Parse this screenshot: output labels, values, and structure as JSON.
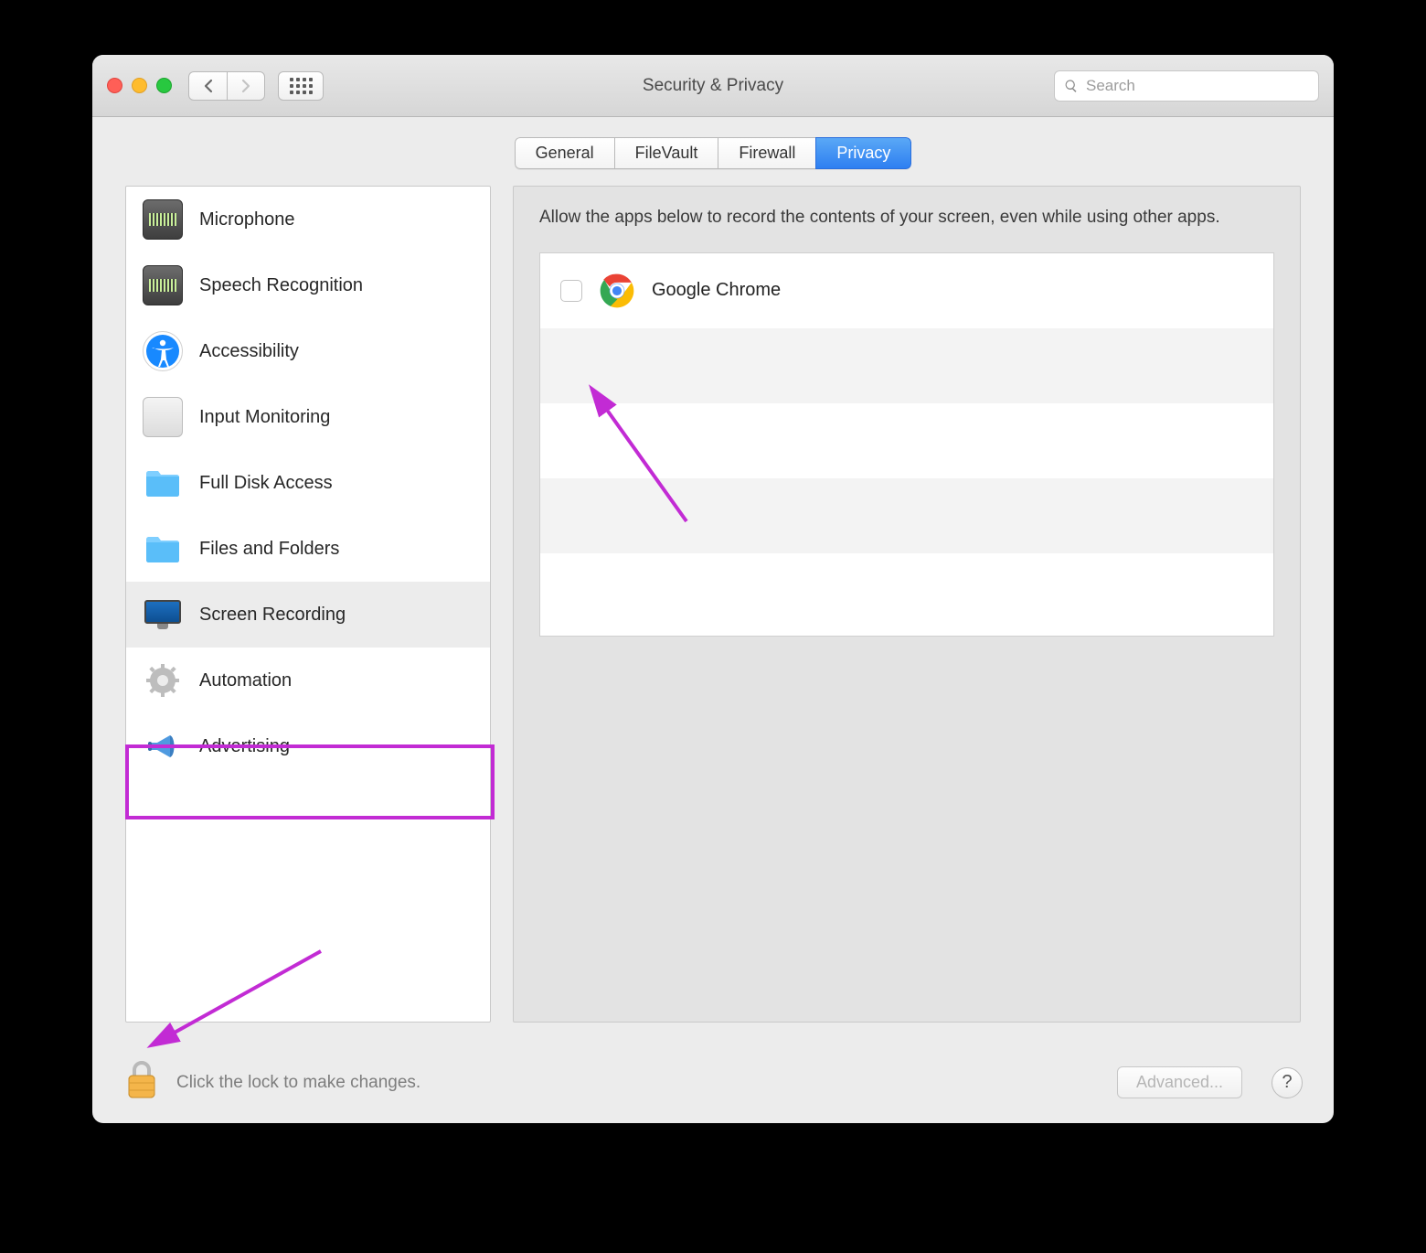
{
  "window": {
    "title": "Security & Privacy"
  },
  "search": {
    "placeholder": "Search"
  },
  "tabs": [
    {
      "label": "General",
      "active": false
    },
    {
      "label": "FileVault",
      "active": false
    },
    {
      "label": "Firewall",
      "active": false
    },
    {
      "label": "Privacy",
      "active": true
    }
  ],
  "sidebar": {
    "items": [
      {
        "label": "Microphone",
        "icon": "mic-icon",
        "selected": false
      },
      {
        "label": "Speech Recognition",
        "icon": "speech-icon",
        "selected": false
      },
      {
        "label": "Accessibility",
        "icon": "accessibility-icon",
        "selected": false
      },
      {
        "label": "Input Monitoring",
        "icon": "keyboard-icon",
        "selected": false
      },
      {
        "label": "Full Disk Access",
        "icon": "folder-icon",
        "selected": false
      },
      {
        "label": "Files and Folders",
        "icon": "folder-icon",
        "selected": false
      },
      {
        "label": "Screen Recording",
        "icon": "screen-icon",
        "selected": true
      },
      {
        "label": "Automation",
        "icon": "gear-icon",
        "selected": false
      },
      {
        "label": "Advertising",
        "icon": "megaphone-icon",
        "selected": false
      }
    ]
  },
  "rightpane": {
    "description": "Allow the apps below to record the contents of your screen, even while using other apps.",
    "apps": [
      {
        "name": "Google Chrome",
        "checked": false,
        "icon": "chrome-icon"
      }
    ]
  },
  "footer": {
    "lock_text": "Click the lock to make changes.",
    "advanced_label": "Advanced...",
    "help_label": "?"
  },
  "annotations": {
    "highlight_box": "screen-recording-item",
    "arrows": [
      "checkbox-arrow",
      "lock-arrow"
    ],
    "color": "#c22bd4"
  }
}
